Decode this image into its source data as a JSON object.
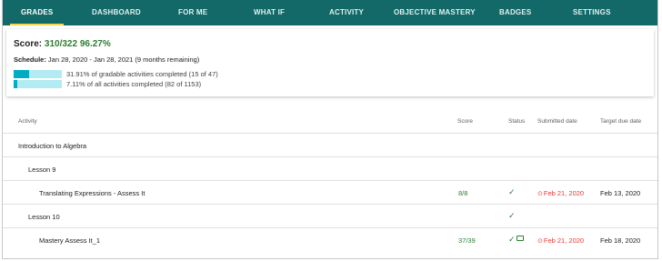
{
  "nav": {
    "tabs": [
      {
        "label": "GRADES",
        "active": true
      },
      {
        "label": "DASHBOARD",
        "active": false
      },
      {
        "label": "FOR ME",
        "active": false
      },
      {
        "label": "WHAT IF",
        "active": false
      },
      {
        "label": "ACTIVITY",
        "active": false
      },
      {
        "label": "OBJECTIVE MASTERY",
        "active": false
      },
      {
        "label": "BADGES",
        "active": false
      },
      {
        "label": "SETTINGS",
        "active": false
      }
    ]
  },
  "summary": {
    "score_label": "Score: ",
    "score_value": "310/322 96.27%",
    "schedule_label": "Schedule:",
    "schedule_value": " Jan 28, 2020 - Jan 28, 2021 (9 months remaining)",
    "progress": [
      {
        "text": "31.91% of gradable activities completed (15 of 47)",
        "fraction": 0.3191
      },
      {
        "text": "7.11% of all activities completed (82 of 1153)",
        "fraction": 0.0711
      }
    ]
  },
  "table": {
    "headers": {
      "activity": "Activity",
      "score": "Score",
      "status": "Status",
      "submitted": "Submitted date",
      "target": "Target due date"
    },
    "rows": [
      {
        "activity": "Introduction to Algebra",
        "level": 0,
        "score": "",
        "status": "",
        "submitted": "",
        "target": ""
      },
      {
        "activity": "Lesson 9",
        "level": 1,
        "score": "",
        "status": "",
        "submitted": "",
        "target": ""
      },
      {
        "activity": "Translating Expressions - Assess It",
        "level": 2,
        "score": "8/8",
        "status": "complete",
        "submitted": "Feb 21, 2020",
        "target": "Feb 13, 2020"
      },
      {
        "activity": "Lesson 10",
        "level": 1,
        "score": "",
        "status": "complete",
        "submitted": "",
        "target": ""
      },
      {
        "activity": "Mastery Assess It_1",
        "level": 2,
        "score": "37/39",
        "status": "complete-comment",
        "submitted": "Feb 21, 2020",
        "target": "Feb 18, 2020"
      }
    ]
  },
  "icons": {
    "check": "check-icon",
    "clock": "clock-icon",
    "comment": "comment-icon"
  },
  "colors": {
    "nav_bg": "#136868",
    "active_underline": "#ffd54f",
    "score_green": "#2e7d32",
    "late_red": "#e53935",
    "bar_fill": "#00acc1",
    "bar_track": "#b2ebf2"
  }
}
